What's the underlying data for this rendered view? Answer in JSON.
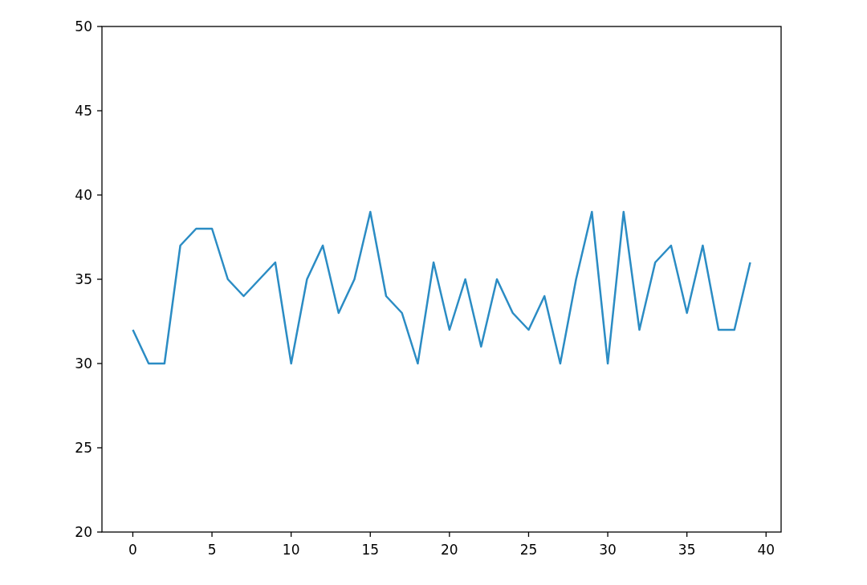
{
  "chart_data": {
    "type": "line",
    "xlim": [
      -1.95,
      40.95
    ],
    "ylim": [
      20,
      50
    ],
    "xticks": [
      0,
      5,
      10,
      15,
      20,
      25,
      30,
      35,
      40
    ],
    "yticks": [
      20,
      25,
      30,
      35,
      40,
      45,
      50
    ],
    "x": [
      0,
      1,
      2,
      3,
      4,
      5,
      6,
      7,
      8,
      9,
      10,
      11,
      12,
      13,
      14,
      15,
      16,
      17,
      18,
      19,
      20,
      21,
      22,
      23,
      24,
      25,
      26,
      27,
      28,
      29,
      30,
      31,
      32,
      33,
      34,
      35,
      36,
      37,
      38,
      39
    ],
    "series": [
      {
        "color": "#2b8cc4",
        "values": [
          32,
          30,
          30,
          37,
          38,
          38,
          35,
          34,
          35,
          36,
          30,
          35,
          37,
          33,
          35,
          39,
          34,
          33,
          30,
          36,
          32,
          35,
          31,
          35,
          33,
          32,
          34,
          30,
          35,
          39,
          30,
          39,
          32,
          36,
          37,
          33,
          37,
          32,
          32,
          36
        ]
      }
    ]
  }
}
